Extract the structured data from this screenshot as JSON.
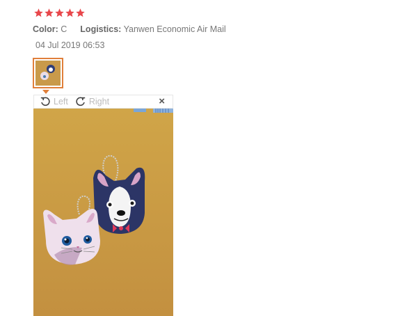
{
  "review": {
    "rating": 5,
    "rating_max": 5,
    "star_color": "#e8474b",
    "color_label": "Color:",
    "color_value": "C",
    "logistics_label": "Logistics:",
    "logistics_value": "Yanwen Economic Air Mail",
    "date": "04 Jul 2019 06:53"
  },
  "viewer": {
    "rotate_left_label": "Left",
    "rotate_right_label": "Right",
    "close_label": "×",
    "rotate_left_icon": "rotate-left-icon",
    "rotate_right_icon": "rotate-right-icon",
    "accent_color": "#e07f3a"
  }
}
